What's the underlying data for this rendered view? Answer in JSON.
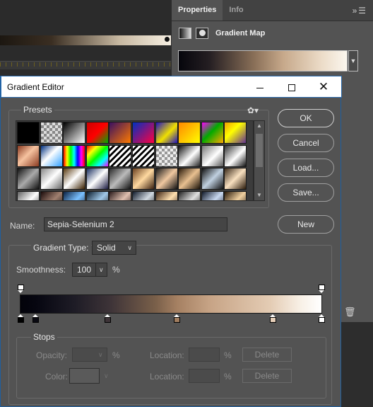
{
  "properties_panel": {
    "tabs": [
      {
        "label": "Properties",
        "active": true
      },
      {
        "label": "Info",
        "active": false
      }
    ],
    "menu_icon": "panel-menu-icon",
    "title": "Gradient Map"
  },
  "dialog": {
    "title": "Gradient Editor",
    "presets_label": "Presets",
    "buttons": {
      "ok": "OK",
      "cancel": "Cancel",
      "load": "Load...",
      "save": "Save...",
      "new": "New"
    },
    "name_label": "Name:",
    "name_value": "Sepia-Selenium 2",
    "gradient_type_label": "Gradient Type:",
    "gradient_type_value": "Solid",
    "smoothness_label": "Smoothness:",
    "smoothness_value": "100",
    "smoothness_unit": "%",
    "stops_label": "Stops",
    "opacity_label": "Opacity:",
    "opacity_unit": "%",
    "location_label": "Location:",
    "location_unit": "%",
    "color_label": "Color:",
    "delete_label": "Delete"
  },
  "presets": [
    "linear-gradient(90deg,#000,#000)",
    "repeating-conic-gradient(#888 0 25%, #ddd 0 50%) 0 0/8px 8px",
    "linear-gradient(135deg,#000,#fff)",
    "linear-gradient(135deg,#c00,#f00 50%,#0a0)",
    "linear-gradient(135deg,#3a1060,#ff7a00)",
    "linear-gradient(135deg,#0030c0,#ff0040)",
    "linear-gradient(135deg,#2010c0,#f0e000 55%,#2010c0)",
    "linear-gradient(135deg,#f80,#ff0)",
    "linear-gradient(135deg,#f0f,#0a0 45%,#fa0)",
    "linear-gradient(135deg,#f0a000,#ff0 40%,#603090)",
    "linear-gradient(135deg,#8a3a20,#f6c3a0 45%,#8a3a20)",
    "linear-gradient(135deg,#003080,#fff 45%,#30a0ff)",
    "linear-gradient(90deg,#f00,#ff0,#0f0,#0ff,#00f,#f0f,#f00)",
    "linear-gradient(135deg,#f00,#ff0 25%,#0f0 50%,#0ff 75%,#f0f)",
    "repeating-linear-gradient(135deg,#fff 0 3px,#000 3px 6px)",
    "repeating-linear-gradient(135deg,#fff 0 3px,#000 3px 6px)",
    "repeating-conic-gradient(#999 0 25%, #eee 0 50%) 0 0/8px 8px",
    "linear-gradient(135deg,#111,#fff 55%,#222)",
    "linear-gradient(135deg,#777,#fff 55%,#555)",
    "linear-gradient(135deg,#333,#fff 55%,#111)",
    "linear-gradient(135deg,#111,#aaa 50%,#111)",
    "linear-gradient(135deg,#888,#fff 50%,#666)",
    "linear-gradient(135deg,#5a3a10,#fff 50%,#3a2000)",
    "linear-gradient(135deg,#1a3060,#fff 50%,#1a1a40)",
    "linear-gradient(135deg,#2a2a2a,#bbb 50%,#111)",
    "linear-gradient(135deg,#6a4020,#ffd9a0 50%,#3a2010)",
    "linear-gradient(135deg,#1a1a1a,#f0c8a0 50%,#111)",
    "linear-gradient(135deg,#2a1a0a,#e8c090 50%,#1a1208)",
    "linear-gradient(135deg,#101010,#c0d0e0 50%,#101010)",
    "linear-gradient(135deg,#3a2a1a,#f8e0c0 50%,#2a1a0a)",
    "linear-gradient(135deg,#606060,#ffffff 50%,#303030)",
    "linear-gradient(135deg,#1a0a0a,#a08070 50%,#0a0505)",
    "linear-gradient(135deg,#0a2040,#7ac0ff 50%,#0a1020)",
    "linear-gradient(135deg,#0a1a2a,#a0c8e8 50%,#101010)",
    "linear-gradient(135deg,#2a1a1a,#e0c0b0 50%,#1a0a0a)",
    "linear-gradient(135deg,#101a2a,#d0d8e0 50%,#0a0a0a)",
    "linear-gradient(135deg,#3a2010,#ffe0b0 50%,#201008)",
    "linear-gradient(135deg,#202020,#e0e0e0 50%,#101010)",
    "linear-gradient(135deg,#101828,#c8d8f0 50%,#080810)",
    "linear-gradient(135deg,#281808,#f0d0a0 50%,#180c04)"
  ],
  "gradient_bar": {
    "opacity_stops": [
      0,
      100
    ],
    "color_stops": [
      {
        "location": 0,
        "color": "#000000"
      },
      {
        "location": 5,
        "color": "#0a0a12"
      },
      {
        "location": 29,
        "color": "#3e3438"
      },
      {
        "location": 52,
        "color": "#a07d5f"
      },
      {
        "location": 84,
        "color": "#e6cfb8"
      },
      {
        "location": 100,
        "color": "#ffffff"
      }
    ]
  }
}
